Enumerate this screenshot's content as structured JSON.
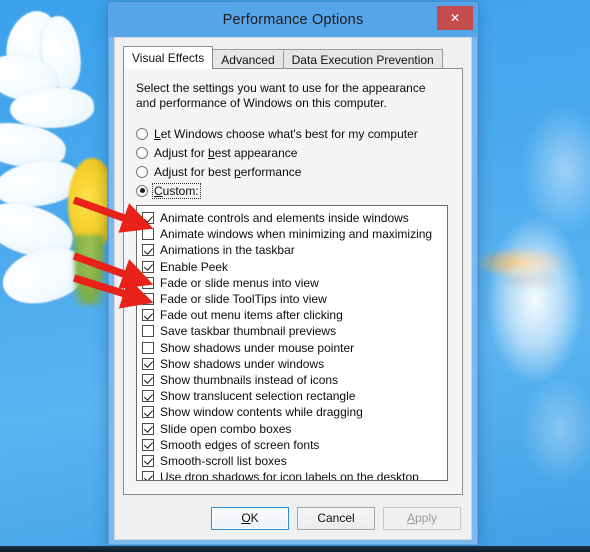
{
  "window": {
    "title": "Performance Options",
    "close_label": "✕",
    "accent_titlebar": "#55a5e8",
    "close_color": "#c34c4c"
  },
  "tabs": [
    {
      "label": "Visual Effects",
      "active": true
    },
    {
      "label": "Advanced",
      "active": false
    },
    {
      "label": "Data Execution Prevention",
      "active": false
    }
  ],
  "panel": {
    "instruction": "Select the settings you want to use for the appearance and performance of Windows on this computer.",
    "radios": [
      {
        "label": "Let Windows choose what's best for my computer",
        "selected": false,
        "focused": false
      },
      {
        "label": "Adjust for best appearance",
        "selected": false,
        "focused": false
      },
      {
        "label": "Adjust for best performance",
        "selected": false,
        "focused": false
      },
      {
        "label": "Custom:",
        "selected": true,
        "focused": true
      }
    ],
    "effects": [
      {
        "label": "Animate controls and elements inside windows",
        "checked": true
      },
      {
        "label": "Animate windows when minimizing and maximizing",
        "checked": false
      },
      {
        "label": "Animations in the taskbar",
        "checked": true
      },
      {
        "label": "Enable Peek",
        "checked": true
      },
      {
        "label": "Fade or slide menus into view",
        "checked": false
      },
      {
        "label": "Fade or slide ToolTips into view",
        "checked": false
      },
      {
        "label": "Fade out menu items after clicking",
        "checked": true
      },
      {
        "label": "Save taskbar thumbnail previews",
        "checked": false
      },
      {
        "label": "Show shadows under mouse pointer",
        "checked": false
      },
      {
        "label": "Show shadows under windows",
        "checked": true
      },
      {
        "label": "Show thumbnails instead of icons",
        "checked": true
      },
      {
        "label": "Show translucent selection rectangle",
        "checked": true
      },
      {
        "label": "Show window contents while dragging",
        "checked": true
      },
      {
        "label": "Slide open combo boxes",
        "checked": true
      },
      {
        "label": "Smooth edges of screen fonts",
        "checked": true
      },
      {
        "label": "Smooth-scroll list boxes",
        "checked": true
      },
      {
        "label": "Use drop shadows for icon labels on the desktop",
        "checked": true
      }
    ]
  },
  "buttons": {
    "ok": "OK",
    "cancel": "Cancel",
    "apply": "Apply"
  },
  "annotations": {
    "arrow_color": "#e8211a",
    "arrows": [
      {
        "points_to": "Animate windows when minimizing and maximizing"
      },
      {
        "points_to": "Fade or slide menus into view"
      },
      {
        "points_to": "Fade or slide ToolTips into view"
      }
    ]
  }
}
